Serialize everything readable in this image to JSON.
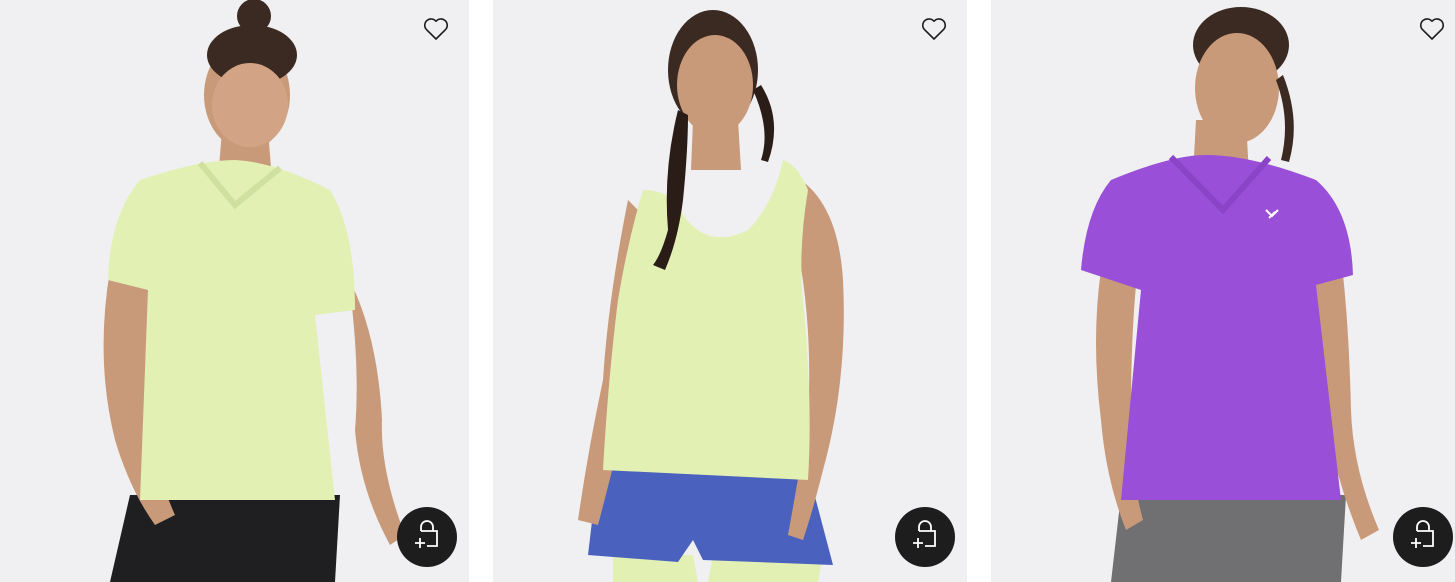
{
  "products": [
    {
      "wishlist_icon": "heart-outline-icon",
      "quick_add_icon": "bag-plus-icon",
      "colors": {
        "shirt": "#e2f0b3",
        "shorts": "#1f1f22",
        "bg": "#f0f0f2"
      }
    },
    {
      "wishlist_icon": "heart-outline-icon",
      "quick_add_icon": "bag-plus-icon",
      "colors": {
        "shirt": "#e2f0b3",
        "shorts": "#4a62bd",
        "bg": "#f0f0f2"
      }
    },
    {
      "wishlist_icon": "heart-outline-icon",
      "quick_add_icon": "bag-plus-icon",
      "colors": {
        "shirt": "#9a4fd8",
        "shorts": "#707072",
        "bg": "#f0f0f2"
      }
    }
  ],
  "colors": {
    "quick_add_bg": "#1d1d1d",
    "icon_stroke": "#1d1d1d"
  }
}
